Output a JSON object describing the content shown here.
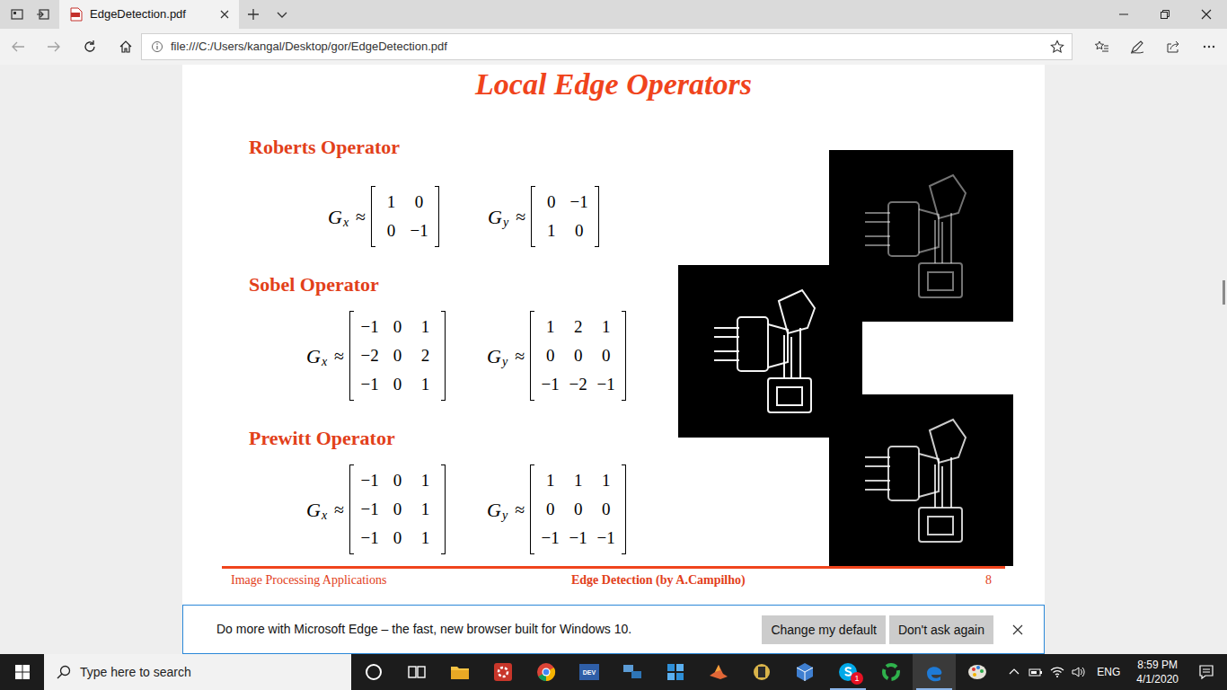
{
  "window": {
    "title": "EdgeDetection.pdf"
  },
  "tabs": [
    {
      "label": "EdgeDetection.pdf",
      "selected": true
    }
  ],
  "nav_buttons": [
    {
      "kind": "back",
      "disabled": true
    },
    {
      "kind": "forward",
      "disabled": true
    },
    {
      "kind": "refresh",
      "disabled": false
    },
    {
      "kind": "home",
      "disabled": false
    }
  ],
  "address": {
    "url": "file:///C:/Users/kangal/Desktop/gor/EdgeDetection.pdf"
  },
  "document": {
    "title": "Local Edge Operators",
    "sections": [
      {
        "heading": "Roberts Operator",
        "matrices": [
          {
            "symbol": "G",
            "sub": "x",
            "approx": "≈",
            "rows": [
              [
                "1",
                "0"
              ],
              [
                "0",
                "−1"
              ]
            ]
          },
          {
            "symbol": "G",
            "sub": "y",
            "approx": "≈",
            "rows": [
              [
                "0",
                "−1"
              ],
              [
                "1",
                "0"
              ]
            ]
          }
        ]
      },
      {
        "heading": "Sobel Operator",
        "matrices": [
          {
            "symbol": "G",
            "sub": "x",
            "approx": "≈",
            "rows": [
              [
                "−1",
                "0",
                "1"
              ],
              [
                "−2",
                "0",
                "2"
              ],
              [
                "−1",
                "0",
                "1"
              ]
            ]
          },
          {
            "symbol": "G",
            "sub": "y",
            "approx": "≈",
            "rows": [
              [
                "1",
                "2",
                "1"
              ],
              [
                "0",
                "0",
                "0"
              ],
              [
                "−1",
                "−2",
                "−1"
              ]
            ]
          }
        ]
      },
      {
        "heading": "Prewitt Operator",
        "matrices": [
          {
            "symbol": "G",
            "sub": "x",
            "approx": "≈",
            "rows": [
              [
                "−1",
                "0",
                "1"
              ],
              [
                "−1",
                "0",
                "1"
              ],
              [
                "−1",
                "0",
                "1"
              ]
            ]
          },
          {
            "symbol": "G",
            "sub": "y",
            "approx": "≈",
            "rows": [
              [
                "1",
                "1",
                "1"
              ],
              [
                "0",
                "0",
                "0"
              ],
              [
                "−1",
                "−1",
                "−1"
              ]
            ]
          }
        ]
      }
    ],
    "footer": {
      "left": "Image Processing Applications",
      "center": "Edge Detection (by A.Campilho)",
      "page": "8"
    }
  },
  "notification": {
    "message": "Do more with Microsoft Edge – the fast, new browser built for Windows 10.",
    "buttons": [
      "Change my default",
      "Don't ask again"
    ]
  },
  "taskbar": {
    "search_placeholder": "Type here to search",
    "apps": [
      {
        "kind": "cortana",
        "open": false,
        "selected": false
      },
      {
        "kind": "taskview",
        "open": false,
        "selected": false
      },
      {
        "kind": "explorer",
        "open": false,
        "selected": false
      },
      {
        "kind": "gear",
        "open": false,
        "selected": false
      },
      {
        "kind": "chrome",
        "open": false,
        "selected": false
      },
      {
        "kind": "devcpp",
        "open": false,
        "selected": false,
        "label": "DEV"
      },
      {
        "kind": "network",
        "open": false,
        "selected": false
      },
      {
        "kind": "store",
        "open": false,
        "selected": false
      },
      {
        "kind": "matlab",
        "open": false,
        "selected": false
      },
      {
        "kind": "tool",
        "open": false,
        "selected": false
      },
      {
        "kind": "vbox",
        "open": false,
        "selected": false
      },
      {
        "kind": "skype",
        "open": true,
        "selected": false,
        "badge": "1"
      },
      {
        "kind": "sync",
        "open": false,
        "selected": false
      },
      {
        "kind": "edge",
        "open": true,
        "selected": true
      },
      {
        "kind": "paint",
        "open": false,
        "selected": false
      }
    ],
    "language": "ENG",
    "time": "8:59 PM",
    "date": "4/1/2020"
  }
}
